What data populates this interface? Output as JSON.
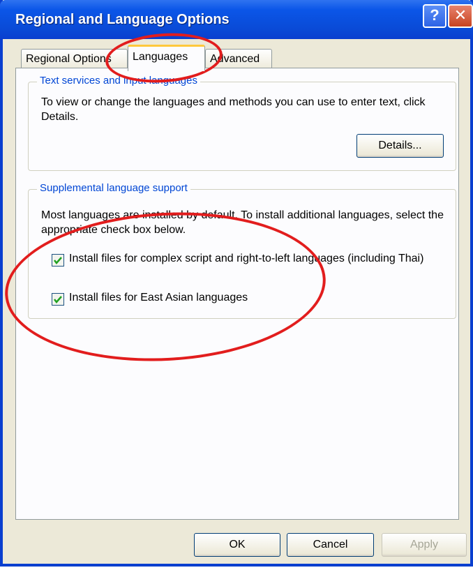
{
  "window": {
    "title": "Regional and Language Options",
    "help_glyph": "?",
    "close_glyph": "✕"
  },
  "tabs": [
    {
      "label": "Regional Options"
    },
    {
      "label": "Languages"
    },
    {
      "label": "Advanced"
    }
  ],
  "text_services": {
    "legend": "Text services and input languages",
    "description": "To view or change the languages and methods you can use to enter text, click Details.",
    "details_label": "Details..."
  },
  "supplemental": {
    "legend": "Supplemental language support",
    "description": "Most languages are installed by default. To install additional languages, select the appropriate check box below.",
    "checkboxes": [
      {
        "label": "Install files for complex script and right-to-left languages (including Thai)",
        "checked": true
      },
      {
        "label": "Install files for East Asian languages",
        "checked": true
      }
    ]
  },
  "footer": {
    "ok_label": "OK",
    "cancel_label": "Cancel",
    "apply_label": "Apply"
  },
  "colors": {
    "title_bar": "#0a4ad6",
    "legend_text": "#0046d5",
    "annotation": "#e21d1d",
    "check_mark": "#21a121"
  }
}
